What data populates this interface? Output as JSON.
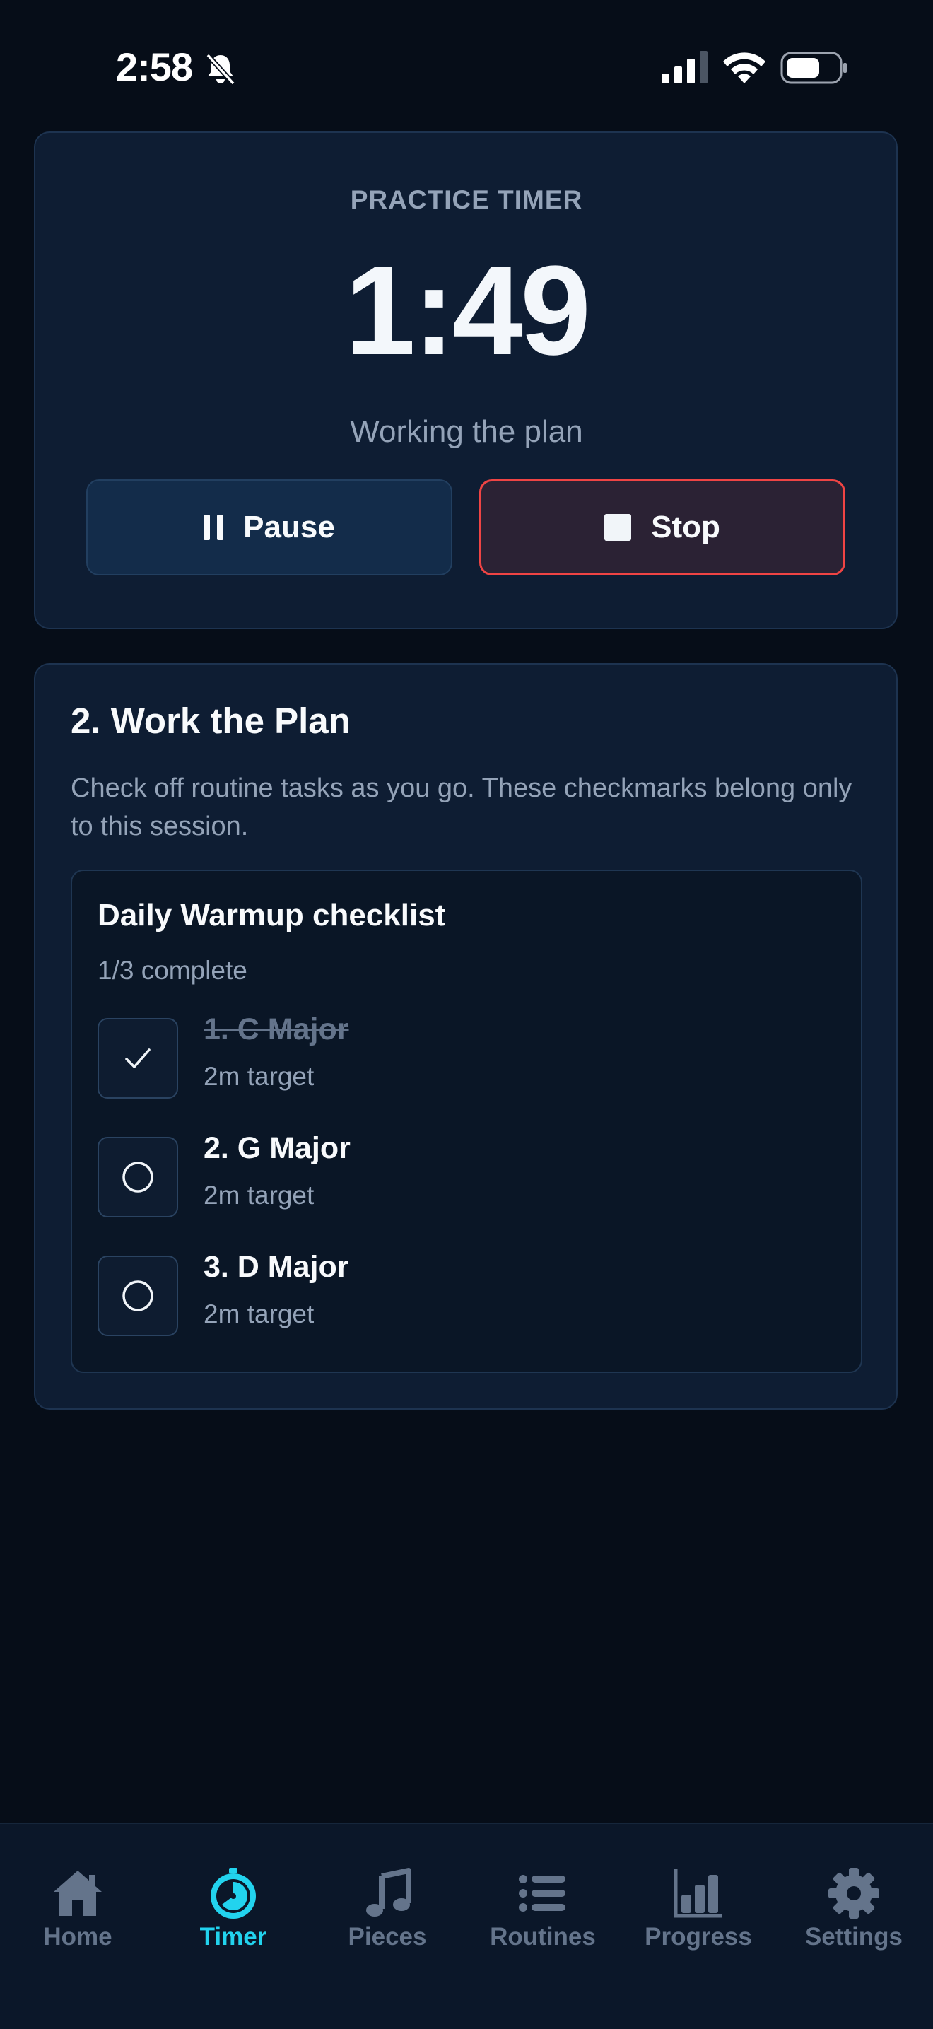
{
  "status_bar": {
    "time": "2:58"
  },
  "timer": {
    "label": "PRACTICE TIMER",
    "value": "1:49",
    "status": "Working the plan",
    "pause_label": "Pause",
    "stop_label": "Stop"
  },
  "plan": {
    "title": "2. Work the Plan",
    "description": "Check off routine tasks as you go. These checkmarks belong only to this session.",
    "checklist": {
      "title": "Daily Warmup checklist",
      "progress": "1/3 complete",
      "tasks": [
        {
          "name": "1. C Major",
          "target": "2m target",
          "checked": true
        },
        {
          "name": "2. G Major",
          "target": "2m target",
          "checked": false
        },
        {
          "name": "3. D Major",
          "target": "2m target",
          "checked": false
        }
      ]
    }
  },
  "tabs": [
    {
      "label": "Home",
      "icon": "home-icon"
    },
    {
      "label": "Timer",
      "icon": "timer-icon",
      "active": true
    },
    {
      "label": "Pieces",
      "icon": "music-note-icon"
    },
    {
      "label": "Routines",
      "icon": "list-icon"
    },
    {
      "label": "Progress",
      "icon": "bar-chart-icon"
    },
    {
      "label": "Settings",
      "icon": "gear-icon"
    }
  ],
  "colors": {
    "background": "#060d18",
    "card": "#0e1d33",
    "accent": "#22d3ee",
    "stop_border": "#ef4444",
    "muted_text": "#94a3b8"
  }
}
